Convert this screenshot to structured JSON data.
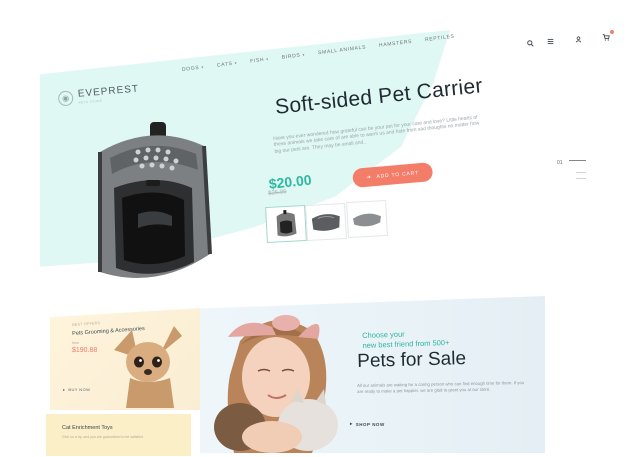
{
  "brand": {
    "name": "EVEPREST",
    "tagline": "PETS STORE"
  },
  "nav": {
    "items": [
      {
        "label": "DOGS",
        "has_caret": true
      },
      {
        "label": "CATS",
        "has_caret": true
      },
      {
        "label": "FISH",
        "has_caret": true
      },
      {
        "label": "BIRDS",
        "has_caret": true
      },
      {
        "label": "SMALL ANIMALS",
        "has_caret": false
      },
      {
        "label": "HAMSTERS",
        "has_caret": false
      },
      {
        "label": "REPTILES",
        "has_caret": false
      }
    ],
    "icons": [
      "search-icon",
      "menu-icon",
      "account-icon",
      "cart-icon"
    ]
  },
  "hero": {
    "title": "Soft-sided Pet Carrier",
    "description": "Have you ever wondered how grateful can be your pet for your care and love? Little hearts of these animals we take care of are able to warm us and hide from sad thoughts no matter how big our pets are. They may be small and..",
    "price": "$20.00",
    "old_price": "$25.00",
    "cart_button": "ADD TO CART",
    "slide_number": "01"
  },
  "promo_card": {
    "label": "BEST OFFERS",
    "title": "Pets Grooming & Accessories",
    "from_label": "from",
    "price": "$190.88",
    "button": "BUY NOW"
  },
  "promo_card_2": {
    "title": "Cat Enrichment Toys",
    "text": "Give us a try, and you are guaranteed to be satisfied"
  },
  "banner": {
    "subtitle_line1": "Choose your",
    "subtitle_line2": "new best friend from 500+",
    "title": "Pets for Sale",
    "text": "All our animals are waiting for a caring person who can find enough time for them. If you are ready to make a pet happier, we are glad to greet you at our store.",
    "button": "SHOP NOW"
  },
  "colors": {
    "accent_teal": "#2fb9a2",
    "accent_coral": "#f47d69",
    "hero_bg": "#dff8f3",
    "text_dark": "#1f2a33"
  }
}
